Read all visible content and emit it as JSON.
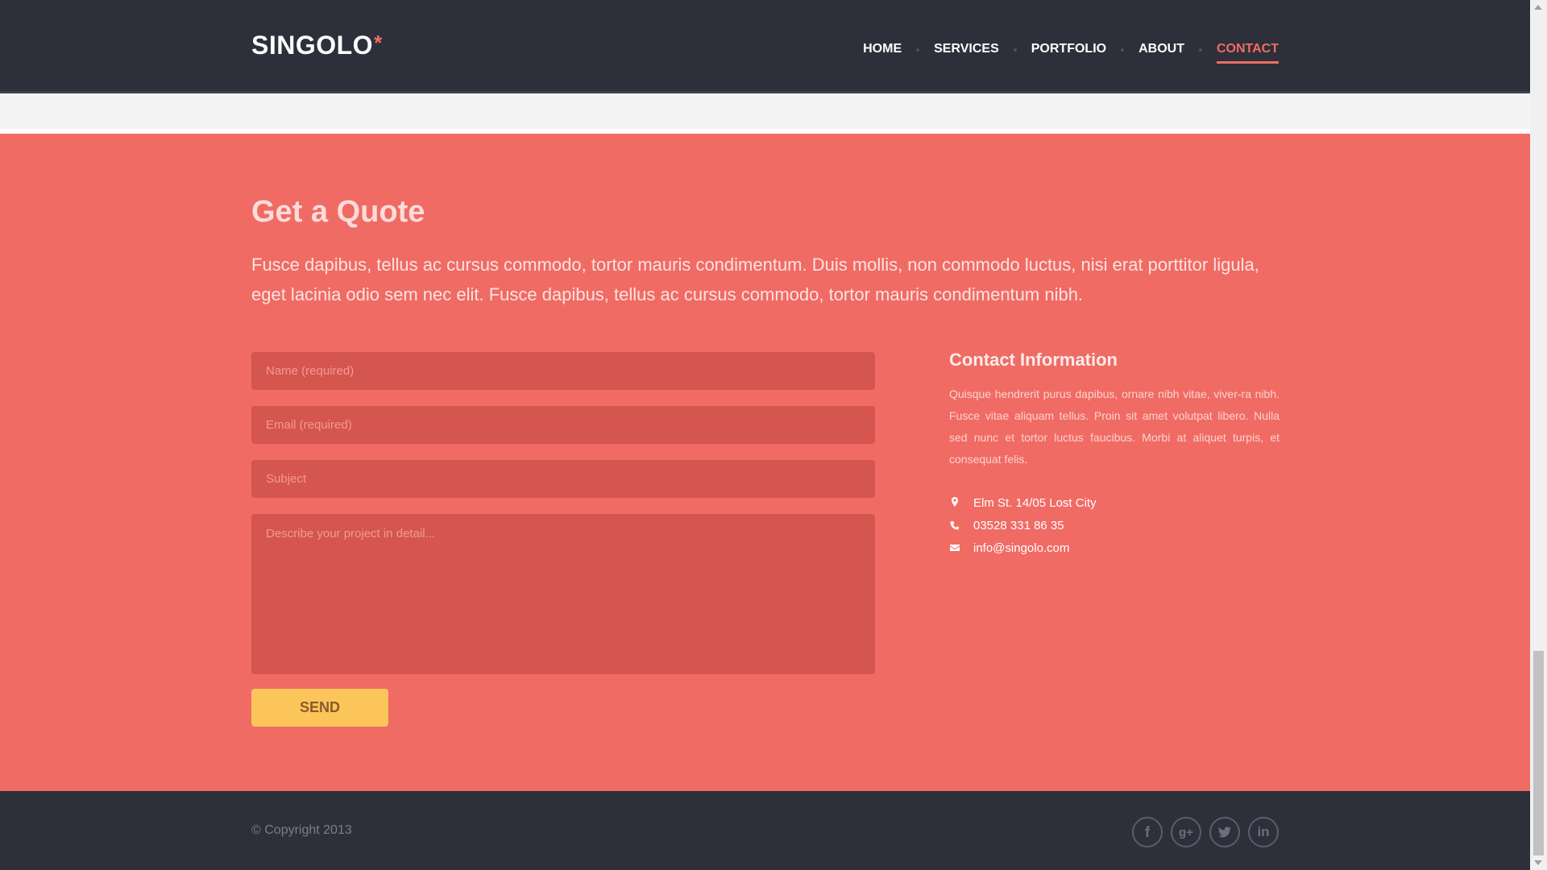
{
  "header": {
    "logo_text": "SINGOLO",
    "logo_star": "*",
    "nav": [
      {
        "label": "HOME"
      },
      {
        "label": "SERVICES"
      },
      {
        "label": "PORTFOLIO"
      },
      {
        "label": "ABOUT"
      },
      {
        "label": "CONTACT",
        "active": true
      }
    ]
  },
  "quote": {
    "title": "Get a Quote",
    "description": "Fusce dapibus, tellus ac cursus commodo, tortor mauris condimentum. Duis mollis, non commodo luctus, nisi erat porttitor ligula, eget lacinia odio sem nec elit. Fusce dapibus, tellus ac cursus commodo, tortor mauris condimentum nibh.",
    "form": {
      "name_placeholder": "Name (required)",
      "email_placeholder": "Email (required)",
      "subject_placeholder": "Subject",
      "details_placeholder": "Describe your project in detail...",
      "send_label": "SEND"
    },
    "contact": {
      "title": "Contact Information",
      "text": "Quisque hendrerit purus dapibus, ornare nibh vitae, viver-ra nibh. Fusce vitae aliquam tellus. Proin sit amet volutpat libero. Nulla sed nunc et tortor luctus faucibus. Morbi at aliquet turpis, et consequat felis.",
      "address": "Elm St. 14/05 Lost City",
      "phone": "03528 331 86 35",
      "email": "info@singolo.com",
      "icons": [
        "location-pin-icon",
        "phone-icon",
        "envelope-icon"
      ]
    }
  },
  "footer": {
    "copyright": "© Copyright 2013",
    "social_icons": [
      "facebook-icon",
      "google-plus-icon",
      "twitter-icon",
      "linkedin-icon"
    ],
    "linkedin_text": "in",
    "facebook_text": "f",
    "google_text": "g+"
  },
  "colors": {
    "header_bg": "#2d303a",
    "quote_bg": "#f06b64",
    "field_bg": "#d5554f",
    "button_bg": "#fbc55a",
    "accent": "#f06c64"
  }
}
